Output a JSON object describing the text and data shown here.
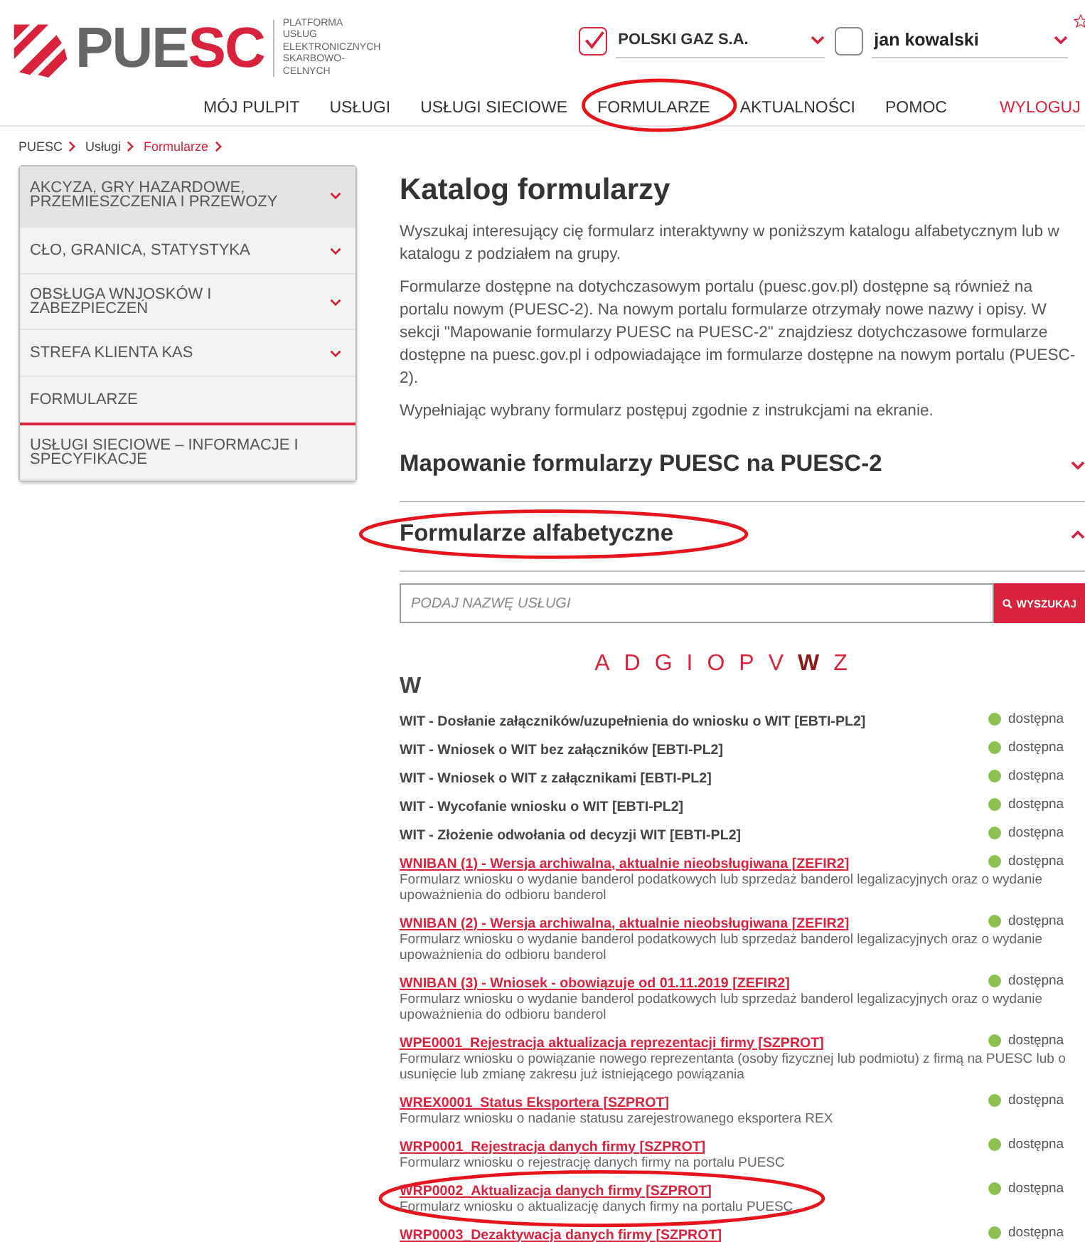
{
  "logo": {
    "wordmark_gray": "PUE",
    "wordmark_red": "SC",
    "tagline": "PLATFORMA\nUSŁUG\nELEKTRONICZNYCH\nSKARBOWO-CELNYCH"
  },
  "account": {
    "company": {
      "name": "POLSKI GAZ S.A.",
      "checked": true
    },
    "user": {
      "name": "jan kowalski",
      "checked": false
    }
  },
  "nav": [
    {
      "label": "MÓJ PULPIT",
      "kind": "link",
      "circled": false
    },
    {
      "label": "USŁUGI",
      "kind": "link",
      "circled": false
    },
    {
      "label": "USŁUGI SIECIOWE",
      "kind": "link",
      "circled": false
    },
    {
      "label": "FORMULARZE",
      "kind": "link",
      "circled": true
    },
    {
      "label": "AKTUALNOŚCI",
      "kind": "link",
      "circled": false
    },
    {
      "label": "POMOC",
      "kind": "link",
      "circled": false
    },
    {
      "label": "WYLOGUJ",
      "kind": "logout",
      "circled": false
    }
  ],
  "breadcrumb": [
    {
      "label": "PUESC",
      "current": false
    },
    {
      "label": "Usługi",
      "current": false
    },
    {
      "label": "Formularze",
      "current": true
    }
  ],
  "sidebar": {
    "items": [
      {
        "label": "AKCYZA, GRY HAZARDOWE, PRZEMIESZCZENIA I PRZEWOZY",
        "expandable": true,
        "highlighted": true,
        "selected": false
      },
      {
        "label": "CŁO, GRANICA, STATYSTYKA",
        "expandable": true,
        "highlighted": false,
        "selected": false
      },
      {
        "label": "OBSŁUGA WNJOSKÓW I ZABEZPIECZEŃ",
        "expandable": true,
        "highlighted": false,
        "selected": false
      },
      {
        "label": "STREFA KLIENTA KAS",
        "expandable": true,
        "highlighted": false,
        "selected": false
      },
      {
        "label": "FORMULARZE",
        "expandable": false,
        "highlighted": false,
        "selected": true
      },
      {
        "label": "USŁUGI SIECIOWE – INFORMACJE I SPECYFIKACJE",
        "expandable": false,
        "highlighted": false,
        "selected": false
      }
    ]
  },
  "main": {
    "title": "Katalog formularzy",
    "paragraphs": [
      "Wyszukaj interesujący cię formularz interaktywny w poniższym katalogu alfabetycznym lub w katalogu z podziałem na grupy.",
      "Formularze dostępne na dotychczasowym portalu (puesc.gov.pl) dostępne są również na portalu nowym (PUESC-2). Na nowym portalu formularze otrzymały nowe nazwy i opisy. W sekcji \"Mapowanie formularzy PUESC na PUESC-2\" znajdziesz dotychczasowe formularze dostępne na puesc.gov.pl i odpowiadające im formularze dostępne na nowym portalu (PUESC-2).",
      "Wypełniając wybrany formularz postępuj zgodnie z instrukcjami na ekranie."
    ],
    "sections": [
      {
        "title": "Mapowanie formularzy PUESC na PUESC-2",
        "expanded": false,
        "circled": false
      },
      {
        "title": "Formularze alfabetyczne",
        "expanded": true,
        "circled": true
      }
    ],
    "search": {
      "placeholder": "PODAJ NAZWĘ USŁUGI",
      "button": "WYSZUKAJ"
    },
    "letters": [
      {
        "label": "A",
        "selected": false
      },
      {
        "label": "D",
        "selected": false
      },
      {
        "label": "G",
        "selected": false
      },
      {
        "label": "I",
        "selected": false
      },
      {
        "label": "O",
        "selected": false
      },
      {
        "label": "P",
        "selected": false
      },
      {
        "label": "V",
        "selected": false
      },
      {
        "label": "W",
        "selected": true
      },
      {
        "label": "Z",
        "selected": false
      }
    ],
    "group_letter": "W",
    "forms": [
      {
        "kind": "plain",
        "title": "WIT - Dosłanie załączników/uzupełnienia do wniosku o WIT [EBTI-PL2]",
        "status": "dostępna",
        "color": "#8cc152",
        "circled": false
      },
      {
        "kind": "plain",
        "title": "WIT - Wniosek o WIT bez załączników [EBTI-PL2]",
        "status": "dostępna",
        "color": "#8cc152",
        "circled": false
      },
      {
        "kind": "plain",
        "title": "WIT - Wniosek o WIT z załącznikami [EBTI-PL2]",
        "status": "dostępna",
        "color": "#8cc152",
        "circled": false
      },
      {
        "kind": "plain",
        "title": "WIT - Wycofanie wniosku o WIT [EBTI-PL2]",
        "status": "dostępna",
        "color": "#8cc152",
        "circled": false
      },
      {
        "kind": "plain",
        "title": "WIT - Złożenie odwołania od decyzji WIT [EBTI-PL2]",
        "status": "dostępna",
        "color": "#8cc152",
        "circled": false
      },
      {
        "kind": "link",
        "title": "WNIBAN (1) - Wersja archiwalna, aktualnie nieobsługiwana [ZEFIR2]",
        "description": "Formularz wniosku o wydanie banderol podatkowych lub sprzedaż banderol legalizacyjnych oraz o wydanie upoważnienia do odbioru banderol",
        "status": "dostępna",
        "color": "#8cc152",
        "circled": false
      },
      {
        "kind": "link",
        "title": "WNIBAN (2) - Wersja archiwalna, aktualnie nieobsługiwana [ZEFIR2]",
        "description": "Formularz wniosku o wydanie banderol podatkowych lub sprzedaż banderol legalizacyjnych oraz o wydanie upoważnienia do odbioru banderol",
        "status": "dostępna",
        "color": "#8cc152",
        "circled": false
      },
      {
        "kind": "link",
        "title": "WNIBAN (3) - Wniosek - obowiązuje od 01.11.2019 [ZEFIR2]",
        "description": "Formularz wniosku o wydanie banderol podatkowych lub sprzedaż banderol legalizacyjnych oraz o wydanie upoważnienia do odbioru banderol",
        "status": "dostępna",
        "color": "#8cc152",
        "circled": false
      },
      {
        "kind": "link",
        "title": "WPE0001_Rejestracja aktualizacja reprezentacji firmy [SZPROT]",
        "description": "Formularz wniosku o powiązanie nowego reprezentanta (osoby fizycznej lub podmiotu) z firmą na PUESC lub o usunięcie lub zmianę zakresu już istniejącego powiązania",
        "status": "dostępna",
        "color": "#8cc152",
        "circled": false
      },
      {
        "kind": "link",
        "title": "WREX0001_Status Eksportera [SZPROT]",
        "description": "Formularz wniosku o nadanie statusu zarejestrowanego eksportera REX",
        "status": "dostępna",
        "color": "#8cc152",
        "circled": false
      },
      {
        "kind": "link",
        "title": "WRP0001_Rejestracja danych firmy [SZPROT]",
        "description": "Formularz wniosku o rejestrację danych firmy na portalu PUESC",
        "status": "dostępna",
        "color": "#8cc152",
        "circled": false
      },
      {
        "kind": "link",
        "title": "WRP0002_Aktualizacja danych firmy [SZPROT]",
        "description": "Formularz wniosku o aktualizację danych firmy na portalu PUESC",
        "status": "dostępna",
        "color": "#8cc152",
        "circled": true
      },
      {
        "kind": "link",
        "title": "WRP0003_Dezaktywacja danych firmy [SZPROT]",
        "status": "dostępna",
        "color": "#8cc152",
        "circled": false
      }
    ]
  }
}
